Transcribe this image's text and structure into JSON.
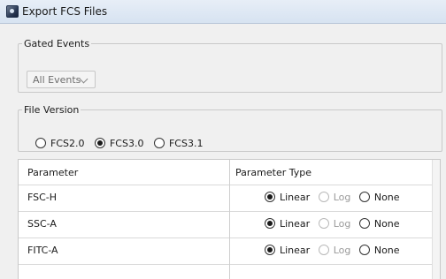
{
  "window": {
    "title": "Export FCS Files",
    "app_icon": "app-icon"
  },
  "gated_events": {
    "legend": "Gated Events",
    "select_value": "All Events"
  },
  "file_version": {
    "legend": "File Version",
    "options": [
      {
        "label": "FCS2.0",
        "selected": false
      },
      {
        "label": "FCS3.0",
        "selected": true
      },
      {
        "label": "FCS3.1",
        "selected": false
      }
    ]
  },
  "table": {
    "headers": [
      "Parameter",
      "Parameter Type"
    ],
    "rows": [
      {
        "parameter": "FSC-H",
        "type_options": [
          "Linear",
          "Log",
          "None"
        ],
        "selected": "Linear"
      },
      {
        "parameter": "SSC-A",
        "type_options": [
          "Linear",
          "Log",
          "None"
        ],
        "selected": "Linear"
      },
      {
        "parameter": "FITC-A",
        "type_options": [
          "Linear",
          "Log",
          "None"
        ],
        "selected": "Linear"
      }
    ]
  }
}
